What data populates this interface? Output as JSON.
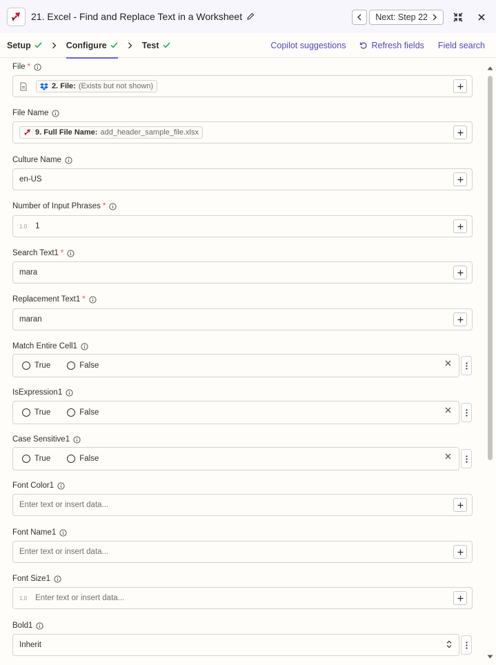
{
  "header": {
    "title": "21. Excel - Find and Replace Text in a Worksheet",
    "next_label": "Next: Step 22"
  },
  "tabs": [
    {
      "label": "Setup",
      "done": true
    },
    {
      "label": "Configure",
      "done": true,
      "active": true
    },
    {
      "label": "Test",
      "done": true
    }
  ],
  "links": {
    "copilot": "Copilot suggestions",
    "refresh": "Refresh fields",
    "search": "Field search"
  },
  "fields": {
    "file": {
      "label": "File",
      "required": true,
      "pill_step": "2. File:",
      "pill_value": "(Exists but not shown)"
    },
    "file_name": {
      "label": "File Name",
      "required": false,
      "pill_step": "9. Full File Name:",
      "pill_value": "add_header_sample_file.xlsx"
    },
    "culture_name": {
      "label": "Culture Name",
      "required": false,
      "value": "en-US"
    },
    "num_input_phrases": {
      "label": "Number of Input Phrases",
      "required": true,
      "type_tag": "1.0",
      "value": "1"
    },
    "search_text1": {
      "label": "Search Text1",
      "required": true,
      "value": "mara"
    },
    "replacement_text1": {
      "label": "Replacement Text1",
      "required": true,
      "value": "maran"
    },
    "match_entire_cell1": {
      "label": "Match Entire Cell1",
      "options": [
        "True",
        "False"
      ]
    },
    "is_expression1": {
      "label": "IsExpression1",
      "options": [
        "True",
        "False"
      ]
    },
    "case_sensitive1": {
      "label": "Case Sensitive1",
      "options": [
        "True",
        "False"
      ]
    },
    "font_color1": {
      "label": "Font Color1",
      "placeholder": "Enter text or insert data..."
    },
    "font_name1": {
      "label": "Font Name1",
      "placeholder": "Enter text or insert data..."
    },
    "font_size1": {
      "label": "Font Size1",
      "type_tag": "1.0",
      "placeholder": "Enter text or insert data..."
    },
    "bold1": {
      "label": "Bold1",
      "value": "Inherit"
    }
  },
  "colors": {
    "accent": "#695be8",
    "link": "#5147c6",
    "required": "#ea5a2d",
    "header_bg": "#f7f6fd",
    "check": "#16a34a"
  }
}
